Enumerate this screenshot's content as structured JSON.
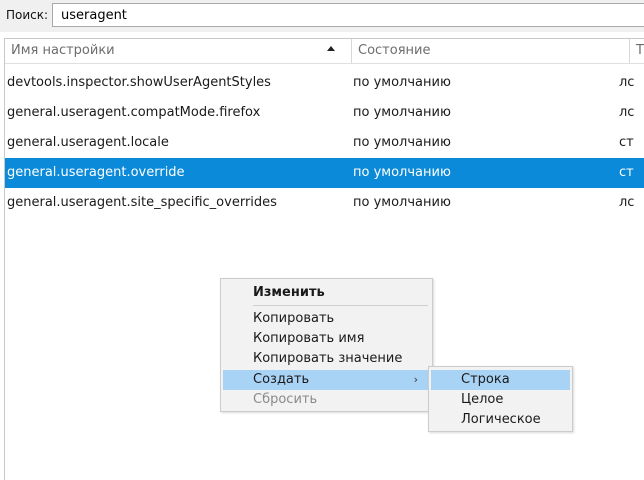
{
  "search": {
    "label": "Поиск:",
    "value": "useragent"
  },
  "table": {
    "columns": [
      "Имя настройки",
      "Состояние",
      "Т"
    ],
    "rows": [
      {
        "name": "devtools.inspector.showUserAgentStyles",
        "status": "по умолчанию",
        "type": "лс"
      },
      {
        "name": "general.useragent.compatMode.firefox",
        "status": "по умолчанию",
        "type": "лс"
      },
      {
        "name": "general.useragent.locale",
        "status": "по умолчанию",
        "type": "ст"
      },
      {
        "name": "general.useragent.override",
        "status": "по умолчанию",
        "type": "ст",
        "selected": true
      },
      {
        "name": "general.useragent.site_specific_overrides",
        "status": "по умолчанию",
        "type": "лс"
      }
    ]
  },
  "context_menu": {
    "items": [
      {
        "label": "Изменить",
        "bold": true
      },
      {
        "label": "Копировать"
      },
      {
        "label": "Копировать имя"
      },
      {
        "label": "Копировать значение"
      },
      {
        "label": "Создать",
        "highlighted": true,
        "submenu": true
      },
      {
        "label": "Сбросить",
        "disabled": true
      }
    ],
    "arrow": "›"
  },
  "submenu": {
    "items": [
      {
        "label": "Строка",
        "highlighted": true
      },
      {
        "label": "Целое"
      },
      {
        "label": "Логическое"
      }
    ]
  },
  "colors": {
    "selection": "#0a8ad8",
    "menu_highlight": "#a9d3f5",
    "menu_background": "#f2f2f2"
  }
}
